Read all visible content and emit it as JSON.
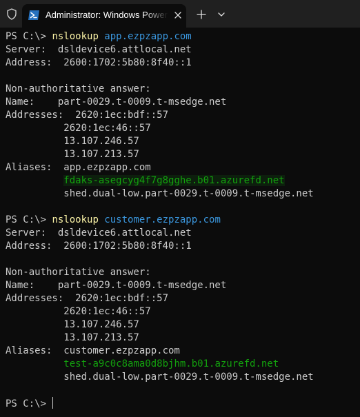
{
  "window": {
    "tab_title": "Administrator: Windows PowerShell",
    "icons": {
      "shield": "shield-icon",
      "powershell": "powershell-icon",
      "close": "close-icon",
      "new_tab": "plus-icon",
      "dropdown": "chevron-down-icon"
    }
  },
  "colors": {
    "background": "#0c0c0c",
    "text": "#cccccc",
    "command": "#f9f1a5",
    "argument": "#3a96dd",
    "highlight": "#13a10e"
  },
  "terminal": {
    "lines": [
      {
        "kind": "prompt",
        "prompt": "PS C:\\> ",
        "command": "nslookup",
        "arg": " app.ezpzapp.com"
      },
      {
        "kind": "text",
        "text": "Server:  dsldevice6.attlocal.net"
      },
      {
        "kind": "text",
        "text": "Address:  2600:1702:5b80:8f40::1"
      },
      {
        "kind": "text",
        "text": ""
      },
      {
        "kind": "text",
        "text": "Non-authoritative answer:"
      },
      {
        "kind": "text",
        "text": "Name:    part-0029.t-0009.t-msedge.net"
      },
      {
        "kind": "text",
        "text": "Addresses:  2620:1ec:bdf::57"
      },
      {
        "kind": "text",
        "text": "          2620:1ec:46::57"
      },
      {
        "kind": "text",
        "text": "          13.107.246.57"
      },
      {
        "kind": "text",
        "text": "          13.107.213.57"
      },
      {
        "kind": "text",
        "text": "Aliases:  app.ezpzapp.com"
      },
      {
        "kind": "highlight",
        "indent": "          ",
        "text": "fdaks-asegcyg4f7g8gghe.b01.azurefd.net",
        "boxed": true
      },
      {
        "kind": "text",
        "text": "          shed.dual-low.part-0029.t-0009.t-msedge.net"
      },
      {
        "kind": "text",
        "text": ""
      },
      {
        "kind": "prompt",
        "prompt": "PS C:\\> ",
        "command": "nslookup",
        "arg": " customer.ezpzapp.com"
      },
      {
        "kind": "text",
        "text": "Server:  dsldevice6.attlocal.net"
      },
      {
        "kind": "text",
        "text": "Address:  2600:1702:5b80:8f40::1"
      },
      {
        "kind": "text",
        "text": ""
      },
      {
        "kind": "text",
        "text": "Non-authoritative answer:"
      },
      {
        "kind": "text",
        "text": "Name:    part-0029.t-0009.t-msedge.net"
      },
      {
        "kind": "text",
        "text": "Addresses:  2620:1ec:bdf::57"
      },
      {
        "kind": "text",
        "text": "          2620:1ec:46::57"
      },
      {
        "kind": "text",
        "text": "          13.107.246.57"
      },
      {
        "kind": "text",
        "text": "          13.107.213.57"
      },
      {
        "kind": "text",
        "text": "Aliases:  customer.ezpzapp.com"
      },
      {
        "kind": "highlight",
        "indent": "          ",
        "text": "test-a9c0c8ama0d8bjhm.b01.azurefd.net",
        "boxed": false
      },
      {
        "kind": "text",
        "text": "          shed.dual-low.part-0029.t-0009.t-msedge.net"
      },
      {
        "kind": "text",
        "text": ""
      },
      {
        "kind": "prompt",
        "prompt": "PS C:\\> ",
        "command": "",
        "arg": "",
        "cursor": true
      }
    ]
  }
}
